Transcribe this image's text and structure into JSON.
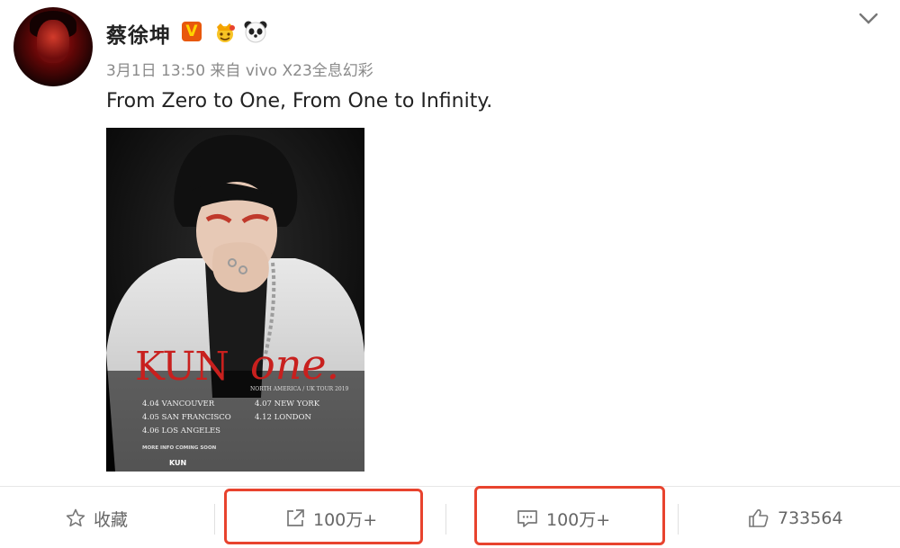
{
  "post": {
    "username": "蔡徐坤",
    "verified_badge": "V",
    "badges": [
      "crown-emoji-icon",
      "panda-icon"
    ],
    "meta": "3月1日 13:50 来自 vivo X23全息幻彩",
    "text": "From Zero to One, From One to Infinity."
  },
  "poster": {
    "title_left": "KUN",
    "title_right": "one.",
    "subtitle": "NORTH AMERICA / UK TOUR 2019",
    "dates_left": [
      "4.04 VANCOUVER",
      "4.05 SAN FRANCISCO",
      "4.06 LOS ANGELES"
    ],
    "dates_right": [
      "4.07 NEW YORK",
      "4.12 LONDON"
    ],
    "more_info": "MORE INFO COMING SOON",
    "footer_logo": "KUN"
  },
  "actions": {
    "favorite_label": "收藏",
    "repost_count": "100万+",
    "comment_count": "100万+",
    "like_count": "733564"
  },
  "colors": {
    "highlight": "#e8432e",
    "vip_badge": "#e8580c",
    "poster_red": "#c8201e"
  }
}
